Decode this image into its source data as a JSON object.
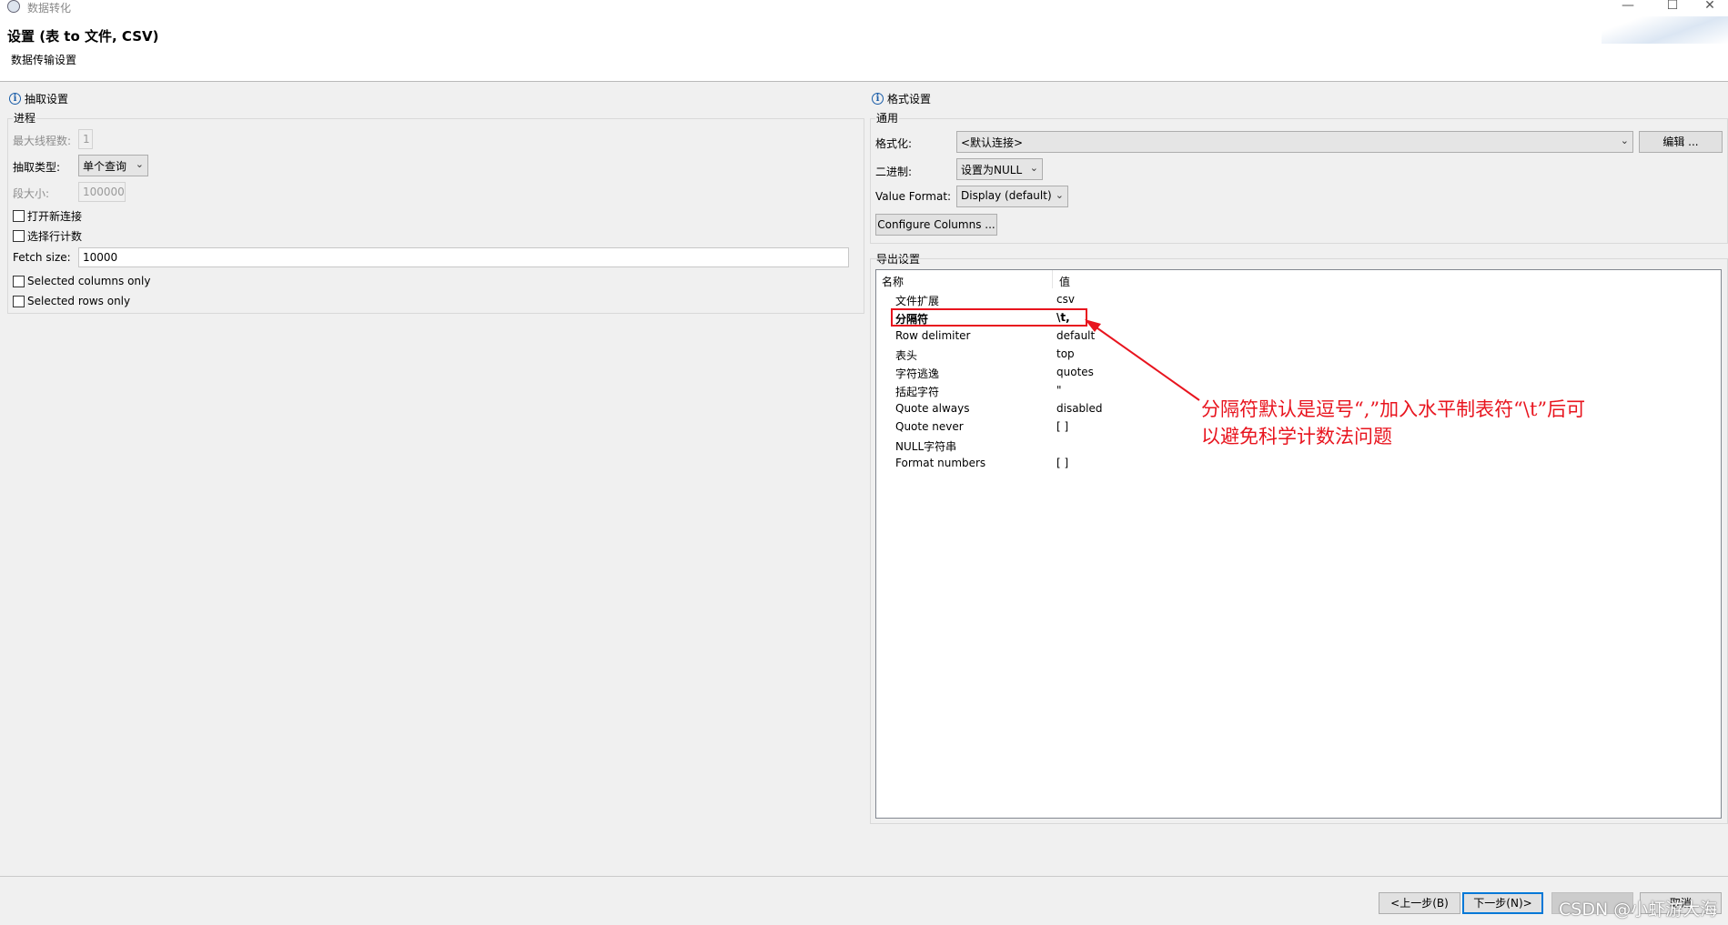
{
  "window": {
    "title": "数据转化",
    "wizard_title": "设置 (表 to 文件, CSV)",
    "wizard_subtitle": "数据传输设置",
    "controls": {
      "minimize": "—",
      "maximize": "☐",
      "close": "✕"
    }
  },
  "extraction": {
    "header": "抽取设置",
    "group_label": "进程",
    "max_threads_label": "最大线程数:",
    "max_threads_value": "1",
    "extract_type_label": "抽取类型:",
    "extract_type_value": "单个查询",
    "segment_size_label": "段大小:",
    "segment_size_value": "100000",
    "open_new_connection": "打开新连接",
    "select_row_count": "选择行计数",
    "fetch_size_label": "Fetch size:",
    "fetch_size_value": "10000",
    "selected_columns_only": "Selected columns only",
    "selected_rows_only": "Selected rows only"
  },
  "format": {
    "header": "格式设置",
    "group_label": "通用",
    "formatting_label": "格式化:",
    "formatting_value": "<默认连接>",
    "edit_button": "编辑 ...",
    "binary_label": "二进制:",
    "binary_value": "设置为NULL",
    "value_format_label": "Value Format:",
    "value_format_value": "Display (default)",
    "configure_columns_button": "Configure Columns ..."
  },
  "export": {
    "group_label": "导出设置",
    "columns": [
      "名称",
      "值"
    ],
    "rows": [
      {
        "name": "文件扩展",
        "value": "csv"
      },
      {
        "name": "分隔符",
        "value": "\\t,"
      },
      {
        "name": "Row delimiter",
        "value": "default"
      },
      {
        "name": "表头",
        "value": "top"
      },
      {
        "name": "字符逃逸",
        "value": "quotes"
      },
      {
        "name": "括起字符",
        "value": "\""
      },
      {
        "name": "Quote always",
        "value": "disabled"
      },
      {
        "name": "Quote never",
        "value": "[ ]"
      },
      {
        "name": "NULL字符串",
        "value": ""
      },
      {
        "name": "Format numbers",
        "value": "[ ]"
      }
    ]
  },
  "annotation": {
    "line1": "分隔符默认是逗号“,”加入水平制表符“\\t”后可",
    "line2": "以避免科学计数法问题",
    "color": "#e8141e"
  },
  "footer": {
    "back_button": "<上一步(B)",
    "next_button": "下一步(N)>",
    "finish_button": "",
    "cancel_button": "取消"
  },
  "watermark": "CSDN @小虾游大海"
}
